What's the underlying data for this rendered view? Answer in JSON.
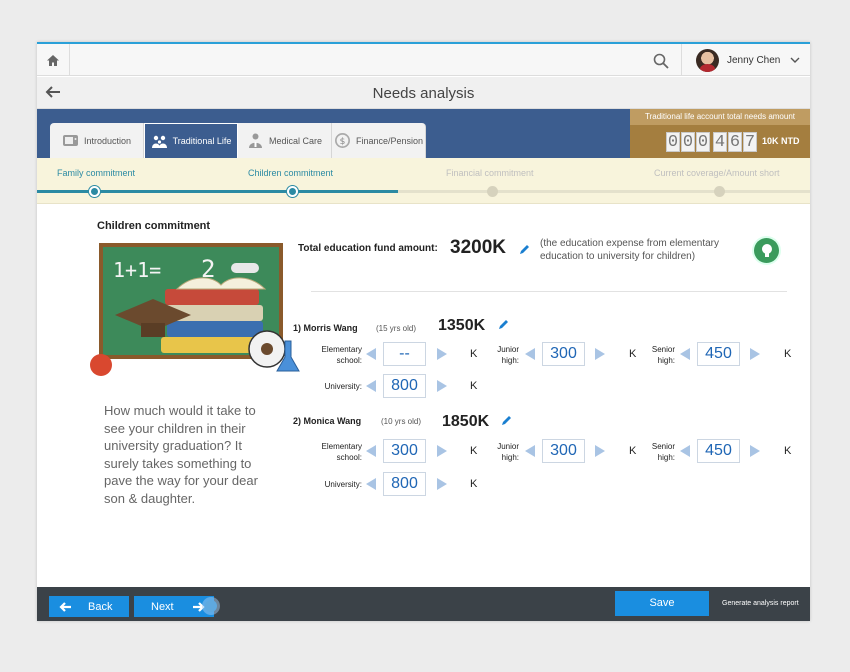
{
  "header": {
    "user_name": "Jenny Chen"
  },
  "page": {
    "title": "Needs analysis"
  },
  "tabs": [
    {
      "label": "Introduction",
      "icon": "tv-icon"
    },
    {
      "label": "Traditional Life",
      "icon": "family-icon"
    },
    {
      "label": "Medical Care",
      "icon": "doctor-icon"
    },
    {
      "label": "Finance/Pension",
      "icon": "dollar-coin-icon"
    }
  ],
  "active_tab": "Traditional Life",
  "summary": {
    "label": "Traditional life account total needs amount",
    "digits": [
      "0",
      "0",
      "0",
      "4",
      "6",
      "7"
    ],
    "unit": "10K NTD"
  },
  "steps": [
    {
      "label": "Family commitment",
      "status": "done"
    },
    {
      "label": "Children commitment",
      "status": "done"
    },
    {
      "label": "Financial commitment",
      "status": "todo"
    },
    {
      "label": "Current coverage/Amount short",
      "status": "todo"
    }
  ],
  "section_title": "Children commitment",
  "quote": "How much would it take to see your children in their university graduation? It surely takes something to pave the way for your dear son & daughter.",
  "total": {
    "label": "Total education fund amount:",
    "value": "3200K",
    "note": "(the education expense from elementary education to university for children)"
  },
  "levels": {
    "elementary": "Elementary school:",
    "junior": "Junior high:",
    "senior": "Senior high:",
    "university": "University:"
  },
  "unit": "K",
  "children": [
    {
      "name": "1) Morris Wang",
      "age": "(15 yrs old)",
      "total": "1350K",
      "elementary": "--",
      "junior": "300",
      "senior": "450",
      "university": "800"
    },
    {
      "name": "2) Monica Wang",
      "age": "(10 yrs old)",
      "total": "1850K",
      "elementary": "300",
      "junior": "300",
      "senior": "450",
      "university": "800"
    }
  ],
  "footer": {
    "back": "Back",
    "next": "Next",
    "save": "Save",
    "report": "Generate analysis report"
  },
  "colors": {
    "primary_blue": "#1a8ee0",
    "header_blue": "#3c5d8f",
    "gold": "#a47e3f",
    "teal": "#2b8aa3"
  }
}
